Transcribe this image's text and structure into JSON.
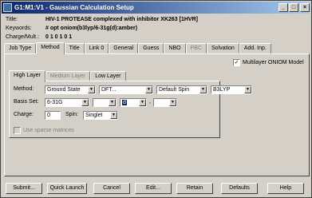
{
  "window": {
    "title": "G1:M1:V1 - Gaussian Calculation Setup",
    "controls": [
      "_",
      "□",
      "×"
    ]
  },
  "header": {
    "title_label": "Title:",
    "title_value": "HIV-1 PROTEASE complexed with inhibitor XK263 [1HVR]",
    "keywords_label": "Keywords:",
    "keywords_value": "# opt oniom(b3lyp/6-31g(d):amber)",
    "charge_label": "Charge/Mult.:",
    "charge_value": "0 1 0 1 0 1"
  },
  "tabs": [
    {
      "label": "Job Type",
      "active": false,
      "disabled": false
    },
    {
      "label": "Method",
      "active": true,
      "disabled": false
    },
    {
      "label": "Title",
      "active": false,
      "disabled": false
    },
    {
      "label": "Link 0",
      "active": false,
      "disabled": false
    },
    {
      "label": "General",
      "active": false,
      "disabled": false
    },
    {
      "label": "Guess",
      "active": false,
      "disabled": false
    },
    {
      "label": "NBO",
      "active": false,
      "disabled": false
    },
    {
      "label": "PBC",
      "active": false,
      "disabled": true
    },
    {
      "label": "Solvation",
      "active": false,
      "disabled": false
    },
    {
      "label": "Add. Inp.",
      "active": false,
      "disabled": false
    }
  ],
  "multilayer": {
    "label": "Multilayer ONIOM Model",
    "checked": true,
    "check_mark": "✓"
  },
  "layer_tabs": [
    {
      "label": "High Layer",
      "active": true
    },
    {
      "label": "Medium Layer",
      "active": false
    },
    {
      "label": "Low Layer",
      "active": false
    }
  ],
  "method": {
    "label": "Method:",
    "state": "Ground State",
    "type": "DFT...",
    "spin": "Default Spin",
    "functional": "B3LYP"
  },
  "basis": {
    "label": "Basis Set:",
    "set": "6-31G",
    "diffuse": "",
    "polarization": "d",
    "separator": ",",
    "polarization2": ""
  },
  "charge": {
    "label": "Charge:",
    "value": "0",
    "spin_label": "Spin:",
    "spin_value": "Singlet"
  },
  "sparse": {
    "label": "Use sparse matrices",
    "checked": false
  },
  "buttons": [
    "Submit...",
    "Quick Launch",
    "Cancel",
    "Edit...",
    "Retain",
    "Defaults",
    "Help"
  ]
}
